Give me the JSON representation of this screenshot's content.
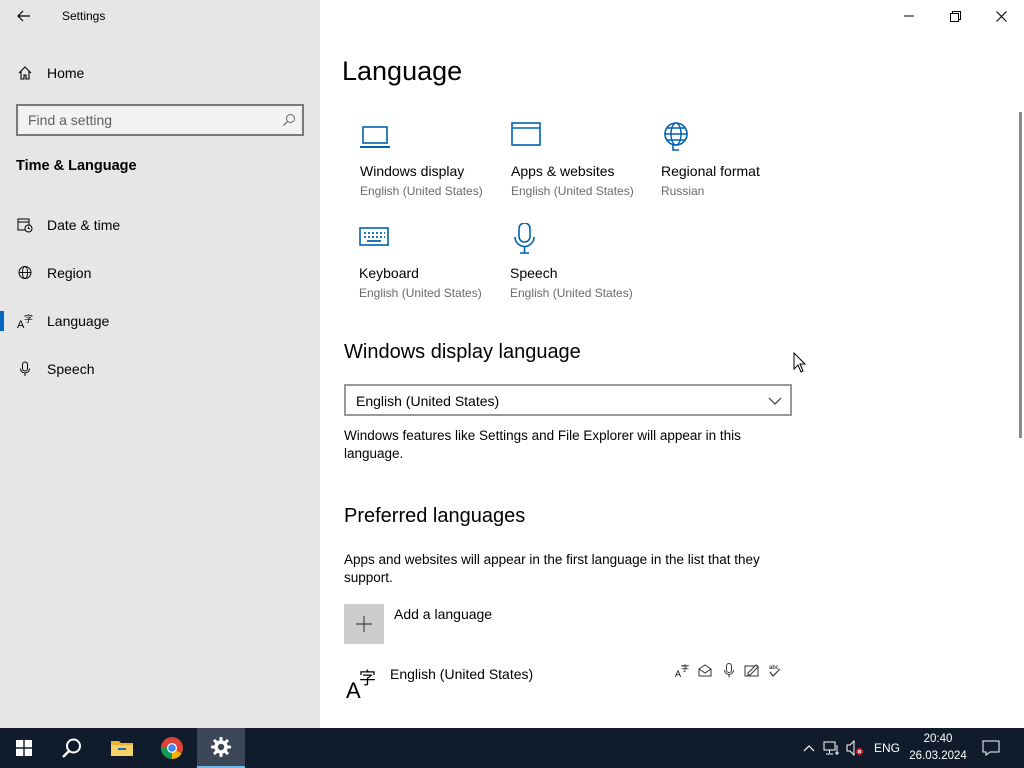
{
  "window": {
    "title": "Settings"
  },
  "sidebar": {
    "home_label": "Home",
    "search_placeholder": "Find a setting",
    "section_title": "Time & Language",
    "items": [
      {
        "label": "Date & time",
        "icon": "date-time-icon"
      },
      {
        "label": "Region",
        "icon": "region-globe-icon"
      },
      {
        "label": "Language",
        "icon": "language-icon",
        "active": true
      },
      {
        "label": "Speech",
        "icon": "microphone-icon"
      }
    ]
  },
  "main": {
    "title": "Language",
    "tiles": [
      {
        "label": "Windows display",
        "sub": "English (United States)",
        "icon": "laptop-icon"
      },
      {
        "label": "Apps & websites",
        "sub": "English (United States)",
        "icon": "browser-window-icon"
      },
      {
        "label": "Regional format",
        "sub": "Russian",
        "icon": "globe-icon"
      },
      {
        "label": "Keyboard",
        "sub": "English (United States)",
        "icon": "keyboard-icon"
      },
      {
        "label": "Speech",
        "sub": "English (United States)",
        "icon": "microphone-icon"
      }
    ],
    "display_language": {
      "heading": "Windows display language",
      "selected": "English (United States)",
      "description": "Windows features like Settings and File Explorer will appear in this language."
    },
    "preferred": {
      "heading": "Preferred languages",
      "description": "Apps and websites will appear in the first language in the list that they support.",
      "add_label": "Add a language",
      "languages": [
        {
          "name": "English (United States)",
          "features": [
            "display-language-icon",
            "text-to-speech-icon",
            "speech-recognition-icon",
            "handwriting-icon",
            "spell-check-icon"
          ]
        }
      ]
    }
  },
  "taskbar": {
    "apps": [
      "windows-start-icon",
      "search-icon",
      "file-explorer-icon",
      "chrome-icon",
      "settings-gear-icon"
    ],
    "input_lang": "ENG",
    "time": "20:40",
    "date": "26.03.2024"
  },
  "colors": {
    "accent": "#0067c0",
    "sidebar_bg": "#e6e6e6",
    "taskbar_bg": "#101c2c",
    "icon_blue": "#0063b1"
  }
}
